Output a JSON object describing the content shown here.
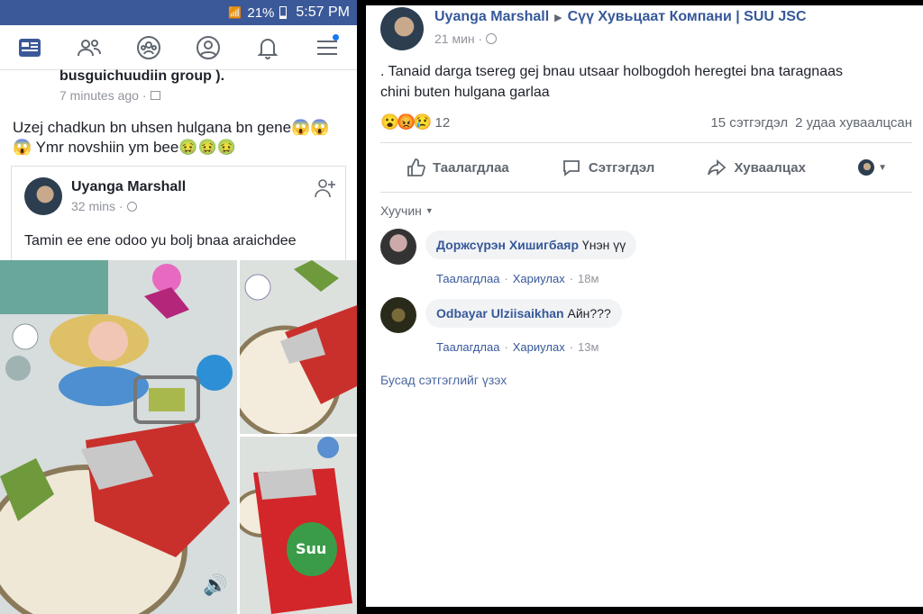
{
  "status_bar": {
    "battery": "21%",
    "time": "5:57 PM"
  },
  "nav": {
    "items": [
      "news-feed-icon",
      "friends-icon",
      "groups-icon",
      "profile-icon",
      "notifications-icon",
      "menu-icon"
    ]
  },
  "left_post": {
    "group_text": "busguichuudiin group ).",
    "time": "7 minutes ago ·",
    "body_line1": "Uzej chadkun bn uhsen hulgana bn gene😱😱",
    "body_line2": "😱 Ymr novshiin ym bee🤢🤢🤢",
    "shared": {
      "author": "Uyanga Marshall",
      "time": "32 mins ·",
      "text": "Tamin ee ene odoo yu bolj bnaa araichdee"
    }
  },
  "right_post": {
    "author": "Uyanga Marshall",
    "arrow": "▶",
    "page": "Сүү Хувьцаат Компани | SUU JSC",
    "time": "21 мин ·",
    "text_line1": ". Tanaid darga tsereg gej bnau utsaar holbogdoh heregtei bna taragnaas",
    "text_line2": "chini buten hulgana garlaa",
    "reaction_emojis": "😮😡😢",
    "reaction_count": "12",
    "comments_count": "15 сэтгэгдэл",
    "shares_count": "2 удаа хуваалцсан",
    "actions": {
      "like": "Таалагдлаа",
      "comment": "Сэтгэгдэл",
      "share": "Хуваалцах"
    },
    "sort_label": "Хуучин",
    "comments": [
      {
        "author": "Доржсүрэн Хишигбаяр",
        "text": "Үнэн үү",
        "like": "Таалагдлаа",
        "reply": "Хариулах",
        "time": "18м"
      },
      {
        "author": "Odbayar Ulziisaikhan",
        "text": "Айн???",
        "like": "Таалагдлаа",
        "reply": "Хариулах",
        "time": "13м"
      }
    ],
    "more_comments": "Бусад сэтгэглийг үзэх"
  },
  "colors": {
    "fb_blue": "#3b5998",
    "link": "#365899",
    "grey": "#90949c"
  }
}
